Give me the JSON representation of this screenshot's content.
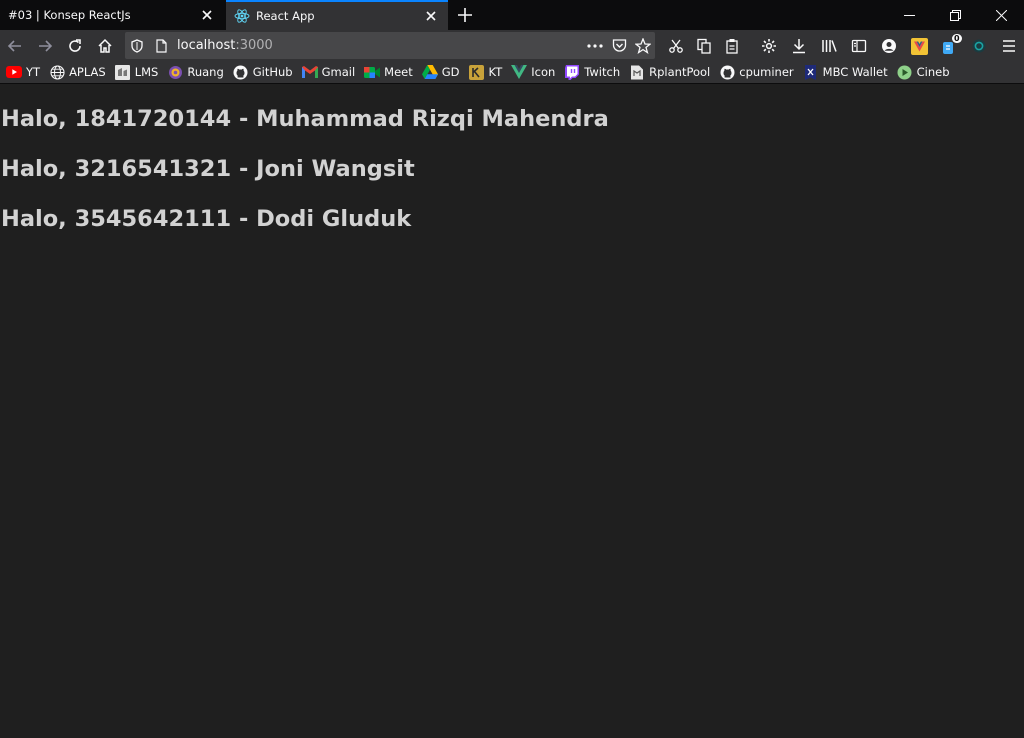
{
  "tabs": [
    {
      "title": "#03 | Konsep ReactJs",
      "active": false
    },
    {
      "title": "React App",
      "active": true
    }
  ],
  "navbar": {
    "url_host": "localhost",
    "url_port": ":3000",
    "notification_badge": "0"
  },
  "bookmarks": [
    {
      "label": "YT",
      "icon": "youtube-icon"
    },
    {
      "label": "APLAS",
      "icon": "globe-icon"
    },
    {
      "label": "LMS",
      "icon": "lms-icon"
    },
    {
      "label": "Ruang",
      "icon": "ruang-icon"
    },
    {
      "label": "GitHub",
      "icon": "github-icon"
    },
    {
      "label": "Gmail",
      "icon": "gmail-icon"
    },
    {
      "label": "Meet",
      "icon": "meet-icon"
    },
    {
      "label": "GD",
      "icon": "google-drive-icon"
    },
    {
      "label": "KT",
      "icon": "kt-icon"
    },
    {
      "label": "Icon",
      "icon": "icon-site-icon"
    },
    {
      "label": "Twitch",
      "icon": "twitch-icon"
    },
    {
      "label": "RplantPool",
      "icon": "rplantpool-icon"
    },
    {
      "label": "cpuminer",
      "icon": "github-icon"
    },
    {
      "label": "MBC Wallet",
      "icon": "wallet-icon"
    },
    {
      "label": "Cineb",
      "icon": "cineb-icon"
    }
  ],
  "page": {
    "greetings": [
      "Halo, 1841720144 - Muhammad Rizqi Mahendra",
      "Halo, 3216541321 - Joni Wangsit",
      "Halo, 3545642111 - Dodi Gluduk"
    ]
  },
  "colors": {
    "accent": "#0a84ff",
    "page_background": "#1f1f1f",
    "text": "#d2d2d2"
  }
}
